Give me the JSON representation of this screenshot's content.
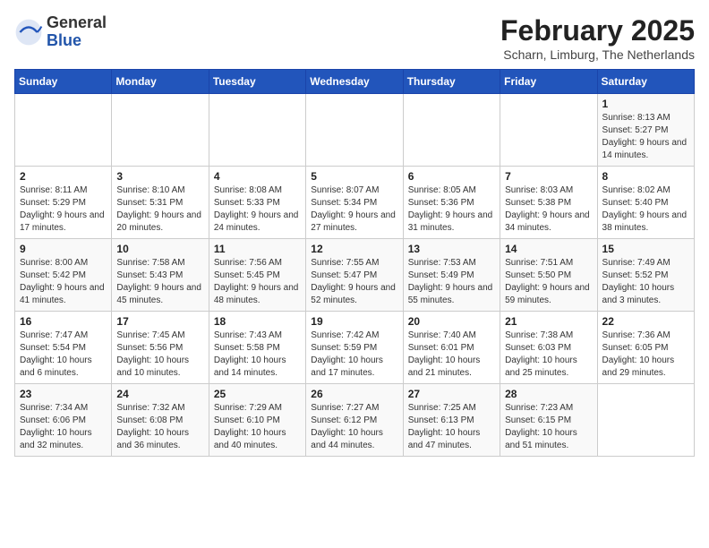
{
  "header": {
    "logo_general": "General",
    "logo_blue": "Blue",
    "title": "February 2025",
    "subtitle": "Scharn, Limburg, The Netherlands"
  },
  "weekdays": [
    "Sunday",
    "Monday",
    "Tuesday",
    "Wednesday",
    "Thursday",
    "Friday",
    "Saturday"
  ],
  "weeks": [
    [
      {
        "day": "",
        "info": ""
      },
      {
        "day": "",
        "info": ""
      },
      {
        "day": "",
        "info": ""
      },
      {
        "day": "",
        "info": ""
      },
      {
        "day": "",
        "info": ""
      },
      {
        "day": "",
        "info": ""
      },
      {
        "day": "1",
        "info": "Sunrise: 8:13 AM\nSunset: 5:27 PM\nDaylight: 9 hours and 14 minutes."
      }
    ],
    [
      {
        "day": "2",
        "info": "Sunrise: 8:11 AM\nSunset: 5:29 PM\nDaylight: 9 hours and 17 minutes."
      },
      {
        "day": "3",
        "info": "Sunrise: 8:10 AM\nSunset: 5:31 PM\nDaylight: 9 hours and 20 minutes."
      },
      {
        "day": "4",
        "info": "Sunrise: 8:08 AM\nSunset: 5:33 PM\nDaylight: 9 hours and 24 minutes."
      },
      {
        "day": "5",
        "info": "Sunrise: 8:07 AM\nSunset: 5:34 PM\nDaylight: 9 hours and 27 minutes."
      },
      {
        "day": "6",
        "info": "Sunrise: 8:05 AM\nSunset: 5:36 PM\nDaylight: 9 hours and 31 minutes."
      },
      {
        "day": "7",
        "info": "Sunrise: 8:03 AM\nSunset: 5:38 PM\nDaylight: 9 hours and 34 minutes."
      },
      {
        "day": "8",
        "info": "Sunrise: 8:02 AM\nSunset: 5:40 PM\nDaylight: 9 hours and 38 minutes."
      }
    ],
    [
      {
        "day": "9",
        "info": "Sunrise: 8:00 AM\nSunset: 5:42 PM\nDaylight: 9 hours and 41 minutes."
      },
      {
        "day": "10",
        "info": "Sunrise: 7:58 AM\nSunset: 5:43 PM\nDaylight: 9 hours and 45 minutes."
      },
      {
        "day": "11",
        "info": "Sunrise: 7:56 AM\nSunset: 5:45 PM\nDaylight: 9 hours and 48 minutes."
      },
      {
        "day": "12",
        "info": "Sunrise: 7:55 AM\nSunset: 5:47 PM\nDaylight: 9 hours and 52 minutes."
      },
      {
        "day": "13",
        "info": "Sunrise: 7:53 AM\nSunset: 5:49 PM\nDaylight: 9 hours and 55 minutes."
      },
      {
        "day": "14",
        "info": "Sunrise: 7:51 AM\nSunset: 5:50 PM\nDaylight: 9 hours and 59 minutes."
      },
      {
        "day": "15",
        "info": "Sunrise: 7:49 AM\nSunset: 5:52 PM\nDaylight: 10 hours and 3 minutes."
      }
    ],
    [
      {
        "day": "16",
        "info": "Sunrise: 7:47 AM\nSunset: 5:54 PM\nDaylight: 10 hours and 6 minutes."
      },
      {
        "day": "17",
        "info": "Sunrise: 7:45 AM\nSunset: 5:56 PM\nDaylight: 10 hours and 10 minutes."
      },
      {
        "day": "18",
        "info": "Sunrise: 7:43 AM\nSunset: 5:58 PM\nDaylight: 10 hours and 14 minutes."
      },
      {
        "day": "19",
        "info": "Sunrise: 7:42 AM\nSunset: 5:59 PM\nDaylight: 10 hours and 17 minutes."
      },
      {
        "day": "20",
        "info": "Sunrise: 7:40 AM\nSunset: 6:01 PM\nDaylight: 10 hours and 21 minutes."
      },
      {
        "day": "21",
        "info": "Sunrise: 7:38 AM\nSunset: 6:03 PM\nDaylight: 10 hours and 25 minutes."
      },
      {
        "day": "22",
        "info": "Sunrise: 7:36 AM\nSunset: 6:05 PM\nDaylight: 10 hours and 29 minutes."
      }
    ],
    [
      {
        "day": "23",
        "info": "Sunrise: 7:34 AM\nSunset: 6:06 PM\nDaylight: 10 hours and 32 minutes."
      },
      {
        "day": "24",
        "info": "Sunrise: 7:32 AM\nSunset: 6:08 PM\nDaylight: 10 hours and 36 minutes."
      },
      {
        "day": "25",
        "info": "Sunrise: 7:29 AM\nSunset: 6:10 PM\nDaylight: 10 hours and 40 minutes."
      },
      {
        "day": "26",
        "info": "Sunrise: 7:27 AM\nSunset: 6:12 PM\nDaylight: 10 hours and 44 minutes."
      },
      {
        "day": "27",
        "info": "Sunrise: 7:25 AM\nSunset: 6:13 PM\nDaylight: 10 hours and 47 minutes."
      },
      {
        "day": "28",
        "info": "Sunrise: 7:23 AM\nSunset: 6:15 PM\nDaylight: 10 hours and 51 minutes."
      },
      {
        "day": "",
        "info": ""
      }
    ]
  ]
}
